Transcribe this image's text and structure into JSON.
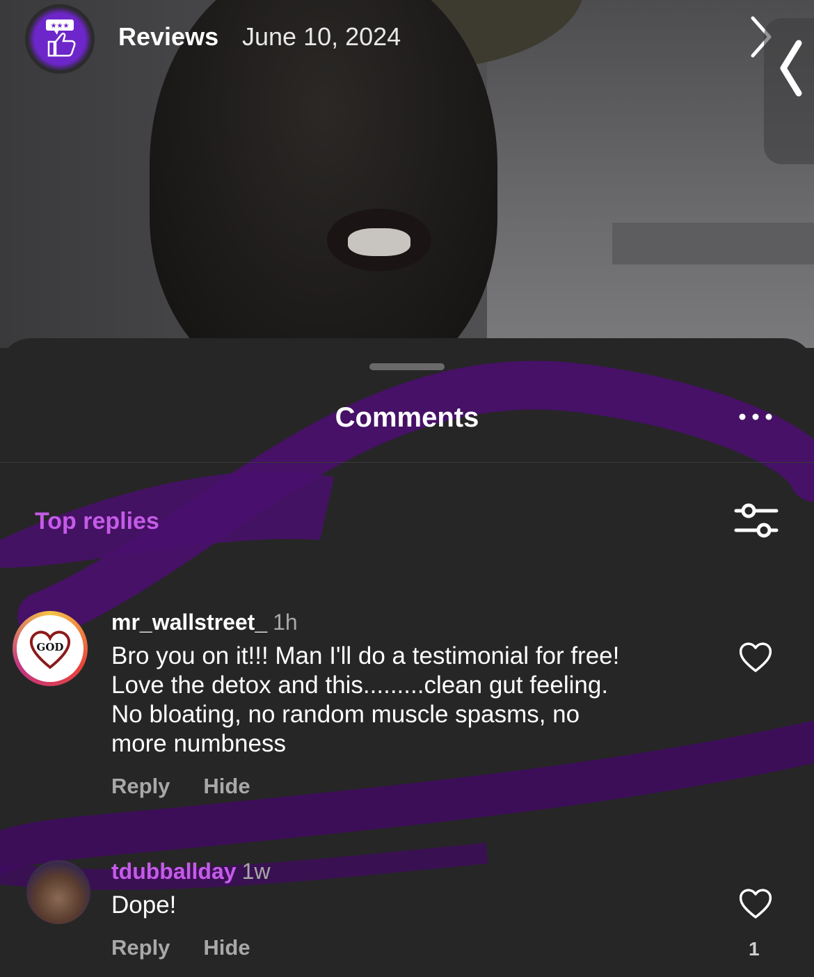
{
  "header": {
    "title": "Reviews",
    "date": "June 10, 2024",
    "avatar_icon": "thumbs-up-review-logo-icon"
  },
  "sheet": {
    "title": "Comments",
    "section_label": "Top replies"
  },
  "comments": [
    {
      "username": "mr_wallstreet_",
      "time": "1h",
      "text": "Bro you on it!!! Man I'll do a testimonial for free!\nLove the detox and this.........clean gut feeling.\nNo bloating,  no random muscle spasms, no\nmore numbness",
      "reply_label": "Reply",
      "hide_label": "Hide",
      "avatar_text": "GOD",
      "likes": ""
    },
    {
      "username": "tdubballday",
      "time": "1w",
      "text": "Dope!",
      "reply_label": "Reply",
      "hide_label": "Hide",
      "avatar_text": "",
      "likes": "1"
    }
  ],
  "colors": {
    "accent_purple": "#c55be8",
    "sheet_bg": "#262626",
    "swoosh": "#4a0f6e"
  }
}
